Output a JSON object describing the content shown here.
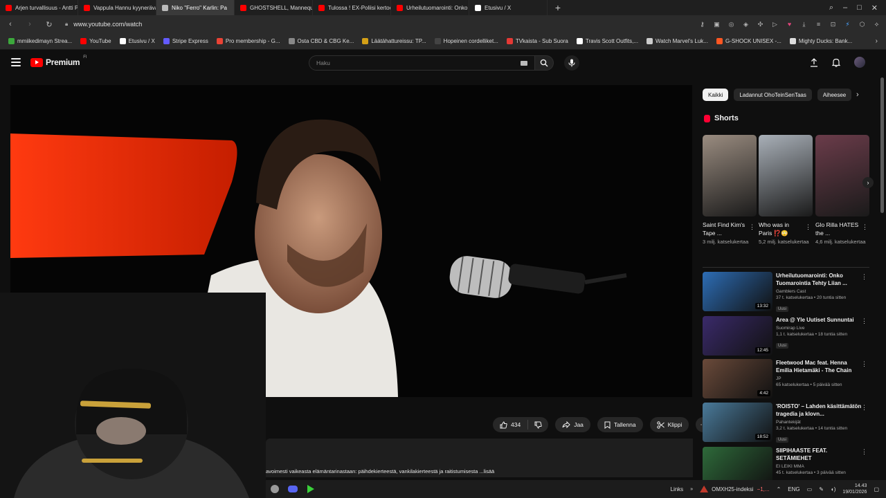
{
  "browser": {
    "tabs": [
      {
        "label": "Arjen turvallisuus - Antti P",
        "color": "#ff0000",
        "active": false
      },
      {
        "label": "Vappula Hannu kyynerävarr",
        "color": "#ff0000",
        "active": false
      },
      {
        "label": "Niko \"Ferro\" Karlin: Pa",
        "color": "#bbbbbb",
        "active": true
      },
      {
        "label": "GHOSTSHELL, Mannequin",
        "color": "#ff0000",
        "active": false
      },
      {
        "label": "Tulossa ! EX-Poliisi kertoo",
        "color": "#ff0000",
        "active": false
      },
      {
        "label": "Urheilutuomarointi: Onko",
        "color": "#ff0000",
        "active": false
      },
      {
        "label": "Etusivu / X",
        "color": "#ffffff",
        "active": false
      }
    ],
    "new_tab": "+",
    "url": "www.youtube.com/watch",
    "bookmarks": [
      {
        "label": "mmiikedimayn Strea...",
        "color": "#3ca83c"
      },
      {
        "label": "YouTube",
        "color": "#ff0000"
      },
      {
        "label": "Etusivu / X",
        "color": "#ffffff"
      },
      {
        "label": "Stripe Express",
        "color": "#635bff"
      },
      {
        "label": "Pro membership - G...",
        "color": "#ea4335"
      },
      {
        "label": "Osta CBD & CBG Ke...",
        "color": "#888888"
      },
      {
        "label": "Läätähattureissu: TP...",
        "color": "#d4a017"
      },
      {
        "label": "Hopeinen cordelliket...",
        "color": "#444444"
      },
      {
        "label": "TVkaista - Sub Suora",
        "color": "#e53935"
      },
      {
        "label": "Travis Scott Outfits,...",
        "color": "#ffffff"
      },
      {
        "label": "Watch Marvel's Luk...",
        "color": "#cccccc"
      },
      {
        "label": "G-SHOCK UNISEX -...",
        "color": "#ff5722"
      },
      {
        "label": "Mighty Ducks: Bank...",
        "color": "#dddddd"
      }
    ]
  },
  "youtube": {
    "logo_text": "Premium",
    "logo_sup": "FI",
    "search_placeholder": "Haku",
    "actions": {
      "like_count": "434",
      "share": "Jaa",
      "save": "Tallenna",
      "clip": "Klippi"
    },
    "description": "avoimesti vaikeasta elämäntarinastaan: päihdekierteestä, vankilakierteestä ja raitistumisesta  ...lisää",
    "chips": [
      "Kaikki",
      "Ladannut OhoTeinSenTaas",
      "Aiheesee"
    ],
    "shorts_title": "Shorts",
    "shorts": [
      {
        "title": "Saint Find Kim's Tape ...",
        "views": "3 milj. katselukertaa",
        "color": "#9a8c80"
      },
      {
        "title": "Who was in Paris ⁉️😳",
        "views": "5,2 milj. katselukertaa",
        "color": "#a9b0b8"
      },
      {
        "title": "Glo Rilla HATES the ...",
        "views": "4,6 milj. katselukertaa",
        "color": "#6b3c4a"
      }
    ],
    "recommendations": [
      {
        "title": "Urheilutuomarointi: Onko Tuomarointia Tehty Liian ...",
        "channel": "Gamblers Cast",
        "meta": "37 t. katselukertaa • 20 tuntia sitten",
        "duration": "13:32",
        "badge": "Uusi",
        "color": "#2d6db5"
      },
      {
        "title": "Area @ Yle Uutiset Sunnuntai",
        "channel": "Suomirap Live",
        "meta": "1,1 t. katselukertaa • 18 tuntia sitten",
        "duration": "12:45",
        "badge": "Uusi",
        "color": "#3a2a6a"
      },
      {
        "title": "Fleetwood Mac feat. Henna Emilia Hietamäki - The Chain",
        "channel": "JP",
        "meta": "65 katselukertaa • 5 päivää sitten",
        "duration": "4:42",
        "badge": "",
        "color": "#6a4a3a"
      },
      {
        "title": "'ROISTO' – Lahden käsittämätön tragedia ja klovn...",
        "channel": "Pahantekijät",
        "meta": "3,2 t. katselukertaa • 14 tuntia sitten",
        "duration": "18:52",
        "badge": "Uusi",
        "color": "#4a7a9a"
      },
      {
        "title": "SIIPIHAASTE FEAT. SETÄMIEHET",
        "channel": "EI LEIKI MMA",
        "meta": "45 t. katselukertaa • 3 päivää sitten",
        "duration": "",
        "badge": "",
        "color": "#2e6a3a"
      }
    ]
  },
  "taskbar": {
    "links": "Links",
    "stock": "OMXH25-indeksi",
    "stock_change": "−1,...",
    "lang": "ENG",
    "time": "14.43",
    "date": "19/01/2026"
  }
}
